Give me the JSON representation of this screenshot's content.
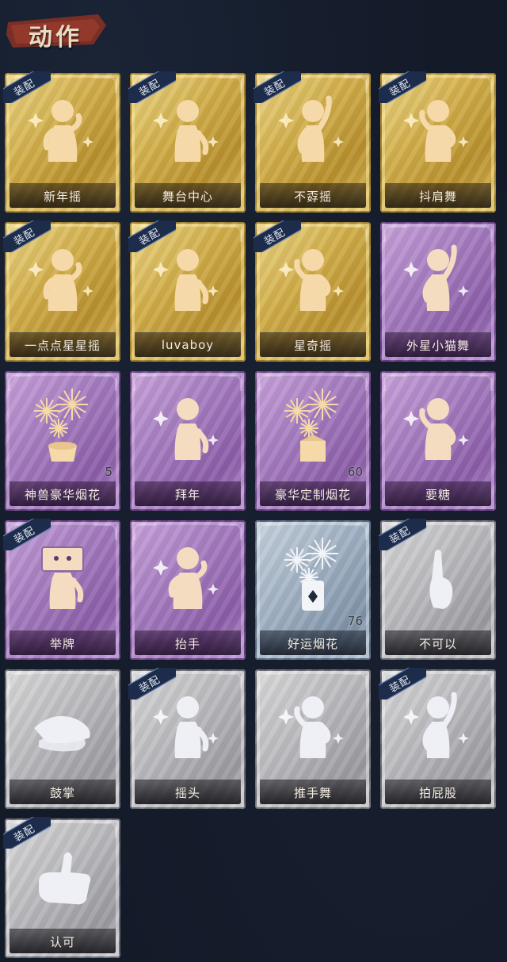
{
  "header": {
    "title": "动作"
  },
  "colors": {
    "background": "#131a28",
    "gold": "#d1ae4a",
    "purple": "#a57dc0",
    "blue": "#9fb0c2",
    "gray": "#b9b9bd",
    "badge": "#1c2c4a"
  },
  "cards": [
    {
      "label": "新年摇",
      "tier": "gold",
      "equipped": true,
      "badge": "装配",
      "icon": "figure-dance-icon"
    },
    {
      "label": "舞台中心",
      "tier": "gold",
      "equipped": true,
      "badge": "装配",
      "icon": "figure-spotlight-icon"
    },
    {
      "label": "不孬摇",
      "tier": "gold",
      "equipped": true,
      "badge": "装配",
      "icon": "figure-arm-up-icon"
    },
    {
      "label": "抖肩舞",
      "tier": "gold",
      "equipped": true,
      "badge": "装配",
      "icon": "figure-shoulder-icon"
    },
    {
      "label": "一点点星星摇",
      "tier": "gold",
      "equipped": true,
      "badge": "装配",
      "icon": "figure-twinkle-icon"
    },
    {
      "label": "luvaboy",
      "tier": "gold",
      "equipped": true,
      "badge": "装配",
      "icon": "figure-cross-arm-icon"
    },
    {
      "label": "星奇摇",
      "tier": "gold",
      "equipped": true,
      "badge": "装配",
      "icon": "figure-wave-icon"
    },
    {
      "label": "外星小猫舞",
      "tier": "purple",
      "equipped": false,
      "badge": "",
      "icon": "figure-cat-dance-icon"
    },
    {
      "label": "神兽豪华烟花",
      "tier": "purple",
      "equipped": false,
      "badge": "",
      "icon": "firework-bowl-icon",
      "count": "5"
    },
    {
      "label": "拜年",
      "tier": "purple",
      "equipped": false,
      "badge": "",
      "icon": "figure-bow-icon"
    },
    {
      "label": "豪华定制烟花",
      "tier": "purple",
      "equipped": false,
      "badge": "",
      "icon": "firework-box-icon",
      "count": "60"
    },
    {
      "label": "要糖",
      "tier": "purple",
      "equipped": false,
      "badge": "",
      "icon": "figure-reach-icon"
    },
    {
      "label": "举牌",
      "tier": "purple",
      "equipped": true,
      "badge": "装配",
      "icon": "figure-sign-icon"
    },
    {
      "label": "抬手",
      "tier": "purple",
      "equipped": false,
      "badge": "",
      "icon": "figure-raise-hand-icon"
    },
    {
      "label": "好运烟花",
      "tier": "blue",
      "equipped": false,
      "badge": "",
      "icon": "firework-can-icon",
      "count": "76"
    },
    {
      "label": "不可以",
      "tier": "gray",
      "equipped": true,
      "badge": "装配",
      "icon": "finger-wag-icon"
    },
    {
      "label": "鼓掌",
      "tier": "gray",
      "equipped": false,
      "badge": "",
      "icon": "clap-hands-icon"
    },
    {
      "label": "摇头",
      "tier": "gray",
      "equipped": true,
      "badge": "装配",
      "icon": "figure-shake-head-icon"
    },
    {
      "label": "推手舞",
      "tier": "gray",
      "equipped": false,
      "badge": "",
      "icon": "figure-push-dance-icon"
    },
    {
      "label": "拍屁股",
      "tier": "gray",
      "equipped": true,
      "badge": "装配",
      "icon": "figure-pat-icon"
    },
    {
      "label": "认可",
      "tier": "gray",
      "equipped": true,
      "badge": "装配",
      "icon": "thumbs-up-icon"
    }
  ]
}
